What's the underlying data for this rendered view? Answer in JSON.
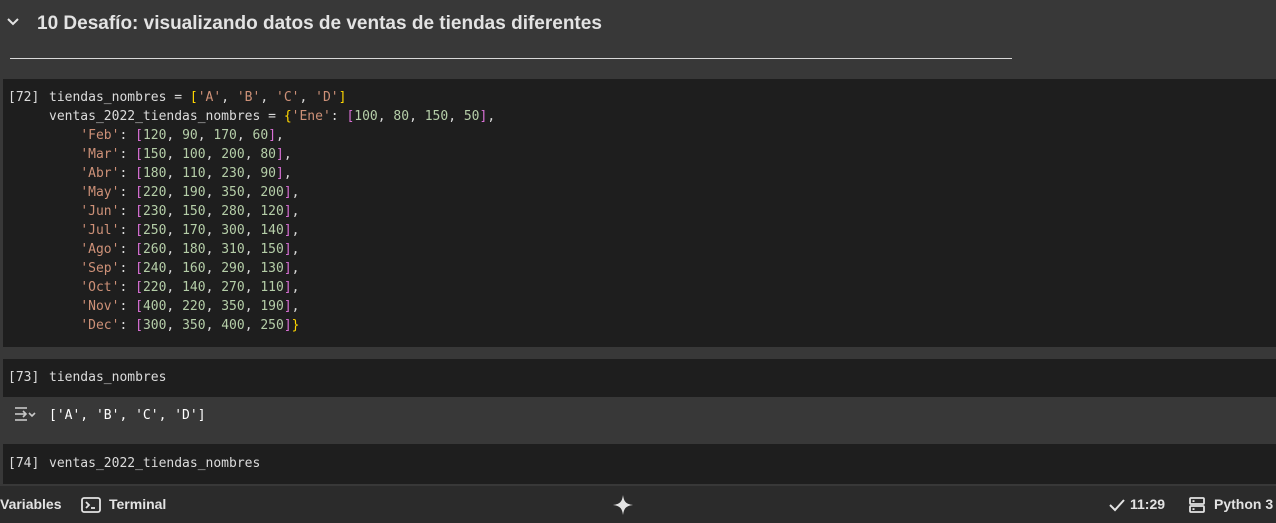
{
  "section": {
    "title": "10 Desafío: visualizando datos de ventas de tiendas diferentes",
    "collapse_icon": "chevron-down-icon"
  },
  "cells": [
    {
      "exec_count": "[72]",
      "lines": [
        [
          [
            "var",
            "tiendas_nombres"
          ],
          [
            "op",
            " = "
          ],
          [
            "b1",
            "["
          ],
          [
            "str",
            "'A'"
          ],
          [
            "p",
            ", "
          ],
          [
            "str",
            "'B'"
          ],
          [
            "p",
            ", "
          ],
          [
            "str",
            "'C'"
          ],
          [
            "p",
            ", "
          ],
          [
            "str",
            "'D'"
          ],
          [
            "b1",
            "]"
          ]
        ],
        [
          [
            "var",
            "ventas_2022_tiendas_nombres"
          ],
          [
            "op",
            " = "
          ],
          [
            "b1",
            "{"
          ],
          [
            "str",
            "'Ene'"
          ],
          [
            "p",
            ": "
          ],
          [
            "b2",
            "["
          ],
          [
            "num",
            "100"
          ],
          [
            "p",
            ", "
          ],
          [
            "num",
            "80"
          ],
          [
            "p",
            ", "
          ],
          [
            "num",
            "150"
          ],
          [
            "p",
            ", "
          ],
          [
            "num",
            "50"
          ],
          [
            "b2",
            "]"
          ],
          [
            "p",
            ","
          ]
        ],
        [
          [
            "p",
            "    "
          ],
          [
            "str",
            "'Feb'"
          ],
          [
            "p",
            ": "
          ],
          [
            "b2",
            "["
          ],
          [
            "num",
            "120"
          ],
          [
            "p",
            ", "
          ],
          [
            "num",
            "90"
          ],
          [
            "p",
            ", "
          ],
          [
            "num",
            "170"
          ],
          [
            "p",
            ", "
          ],
          [
            "num",
            "60"
          ],
          [
            "b2",
            "]"
          ],
          [
            "p",
            ","
          ]
        ],
        [
          [
            "p",
            "    "
          ],
          [
            "str",
            "'Mar'"
          ],
          [
            "p",
            ": "
          ],
          [
            "b2",
            "["
          ],
          [
            "num",
            "150"
          ],
          [
            "p",
            ", "
          ],
          [
            "num",
            "100"
          ],
          [
            "p",
            ", "
          ],
          [
            "num",
            "200"
          ],
          [
            "p",
            ", "
          ],
          [
            "num",
            "80"
          ],
          [
            "b2",
            "]"
          ],
          [
            "p",
            ","
          ]
        ],
        [
          [
            "p",
            "    "
          ],
          [
            "str",
            "'Abr'"
          ],
          [
            "p",
            ": "
          ],
          [
            "b2",
            "["
          ],
          [
            "num",
            "180"
          ],
          [
            "p",
            ", "
          ],
          [
            "num",
            "110"
          ],
          [
            "p",
            ", "
          ],
          [
            "num",
            "230"
          ],
          [
            "p",
            ", "
          ],
          [
            "num",
            "90"
          ],
          [
            "b2",
            "]"
          ],
          [
            "p",
            ","
          ]
        ],
        [
          [
            "p",
            "    "
          ],
          [
            "str",
            "'May'"
          ],
          [
            "p",
            ": "
          ],
          [
            "b2",
            "["
          ],
          [
            "num",
            "220"
          ],
          [
            "p",
            ", "
          ],
          [
            "num",
            "190"
          ],
          [
            "p",
            ", "
          ],
          [
            "num",
            "350"
          ],
          [
            "p",
            ", "
          ],
          [
            "num",
            "200"
          ],
          [
            "b2",
            "]"
          ],
          [
            "p",
            ","
          ]
        ],
        [
          [
            "p",
            "    "
          ],
          [
            "str",
            "'Jun'"
          ],
          [
            "p",
            ": "
          ],
          [
            "b2",
            "["
          ],
          [
            "num",
            "230"
          ],
          [
            "p",
            ", "
          ],
          [
            "num",
            "150"
          ],
          [
            "p",
            ", "
          ],
          [
            "num",
            "280"
          ],
          [
            "p",
            ", "
          ],
          [
            "num",
            "120"
          ],
          [
            "b2",
            "]"
          ],
          [
            "p",
            ","
          ]
        ],
        [
          [
            "p",
            "    "
          ],
          [
            "str",
            "'Jul'"
          ],
          [
            "p",
            ": "
          ],
          [
            "b2",
            "["
          ],
          [
            "num",
            "250"
          ],
          [
            "p",
            ", "
          ],
          [
            "num",
            "170"
          ],
          [
            "p",
            ", "
          ],
          [
            "num",
            "300"
          ],
          [
            "p",
            ", "
          ],
          [
            "num",
            "140"
          ],
          [
            "b2",
            "]"
          ],
          [
            "p",
            ","
          ]
        ],
        [
          [
            "p",
            "    "
          ],
          [
            "str",
            "'Ago'"
          ],
          [
            "p",
            ": "
          ],
          [
            "b2",
            "["
          ],
          [
            "num",
            "260"
          ],
          [
            "p",
            ", "
          ],
          [
            "num",
            "180"
          ],
          [
            "p",
            ", "
          ],
          [
            "num",
            "310"
          ],
          [
            "p",
            ", "
          ],
          [
            "num",
            "150"
          ],
          [
            "b2",
            "]"
          ],
          [
            "p",
            ","
          ]
        ],
        [
          [
            "p",
            "    "
          ],
          [
            "str",
            "'Sep'"
          ],
          [
            "p",
            ": "
          ],
          [
            "b2",
            "["
          ],
          [
            "num",
            "240"
          ],
          [
            "p",
            ", "
          ],
          [
            "num",
            "160"
          ],
          [
            "p",
            ", "
          ],
          [
            "num",
            "290"
          ],
          [
            "p",
            ", "
          ],
          [
            "num",
            "130"
          ],
          [
            "b2",
            "]"
          ],
          [
            "p",
            ","
          ]
        ],
        [
          [
            "p",
            "    "
          ],
          [
            "str",
            "'Oct'"
          ],
          [
            "p",
            ": "
          ],
          [
            "b2",
            "["
          ],
          [
            "num",
            "220"
          ],
          [
            "p",
            ", "
          ],
          [
            "num",
            "140"
          ],
          [
            "p",
            ", "
          ],
          [
            "num",
            "270"
          ],
          [
            "p",
            ", "
          ],
          [
            "num",
            "110"
          ],
          [
            "b2",
            "]"
          ],
          [
            "p",
            ","
          ]
        ],
        [
          [
            "p",
            "    "
          ],
          [
            "str",
            "'Nov'"
          ],
          [
            "p",
            ": "
          ],
          [
            "b2",
            "["
          ],
          [
            "num",
            "400"
          ],
          [
            "p",
            ", "
          ],
          [
            "num",
            "220"
          ],
          [
            "p",
            ", "
          ],
          [
            "num",
            "350"
          ],
          [
            "p",
            ", "
          ],
          [
            "num",
            "190"
          ],
          [
            "b2",
            "]"
          ],
          [
            "p",
            ","
          ]
        ],
        [
          [
            "p",
            "    "
          ],
          [
            "str",
            "'Dec'"
          ],
          [
            "p",
            ": "
          ],
          [
            "b2",
            "["
          ],
          [
            "num",
            "300"
          ],
          [
            "p",
            ", "
          ],
          [
            "num",
            "350"
          ],
          [
            "p",
            ", "
          ],
          [
            "num",
            "400"
          ],
          [
            "p",
            ", "
          ],
          [
            "num",
            "250"
          ],
          [
            "b2",
            "]"
          ],
          [
            "b1",
            "}"
          ]
        ]
      ]
    },
    {
      "exec_count": "[73]",
      "lines": [
        [
          [
            "var",
            "tiendas_nombres"
          ]
        ]
      ]
    },
    {
      "exec_count": "[74]",
      "lines": [
        [
          [
            "var",
            "ventas_2022_tiendas_nombres"
          ]
        ]
      ]
    }
  ],
  "output": {
    "text": "['A', 'B', 'C', 'D']",
    "icon": "output-expand-icon"
  },
  "status_bar": {
    "variables_label": "Variables",
    "terminal_label": "Terminal",
    "terminal_icon": "terminal-icon",
    "center_icon": "sparkle-icon",
    "time": "11:29",
    "time_icon": "checkmark-icon",
    "kernel_label": "Python 3",
    "kernel_icon": "server-icon"
  },
  "colors": {
    "background": "#383838",
    "cell_background": "#1e1e1e",
    "string": "#ce9178",
    "number": "#b5cea8",
    "bracket_level1": "#ffd700",
    "bracket_level2": "#da70d6"
  }
}
